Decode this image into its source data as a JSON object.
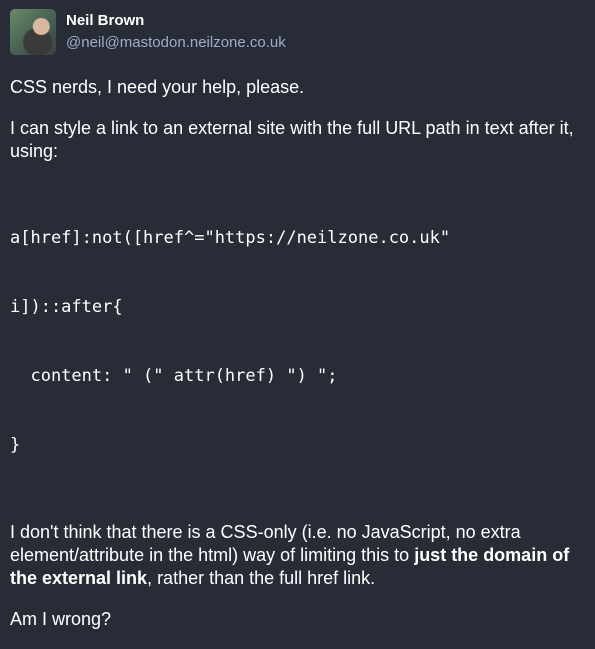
{
  "post": {
    "author": {
      "display_name": "Neil Brown",
      "handle": "@neil@mastodon.neilzone.co.uk"
    },
    "paragraph1": "CSS nerds, I need your help, please.",
    "paragraph2": "I can style a link to an external site with the full URL path in text after it, using:",
    "code_lines": [
      "a[href]:not([href^=\"https://neilzone.co.uk\"",
      "i])::after{",
      "  content: \" (\" attr(href) \") \";",
      "}"
    ],
    "paragraph3": {
      "text_before": "I don't think that there is a CSS-only (i.e. no JavaScript, no extra element/attribute in the html) way of limiting this to ",
      "bold": "just the domain of the external link",
      "text_after": ", rather than the full href link."
    },
    "paragraph4": "Am I wrong?"
  }
}
